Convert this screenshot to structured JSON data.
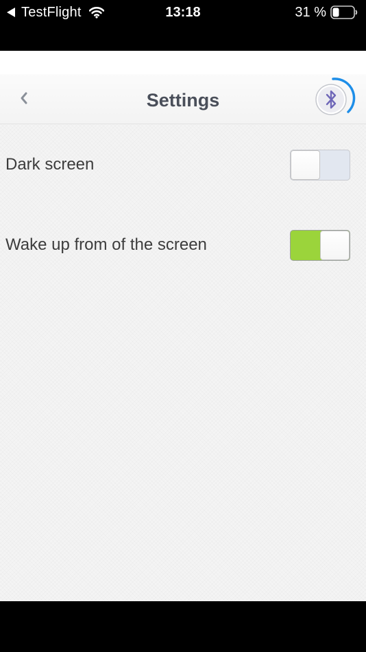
{
  "status_bar": {
    "back_app": "TestFlight",
    "time": "13:18",
    "battery": "31 %",
    "battery_level": 0.31
  },
  "nav": {
    "title": "Settings",
    "back_icon": "chevron-left-icon",
    "bluetooth_icon": "bluetooth-icon"
  },
  "settings": [
    {
      "label": "Dark screen",
      "enabled": false
    },
    {
      "label": "Wake up from of the screen",
      "enabled": true
    }
  ],
  "colors": {
    "toggle_on": "#9bd43b",
    "toggle_off": "#e2e7f0",
    "title_text": "#4a4f5a",
    "bluetooth_accent": "#1e8ee8",
    "bluetooth_glyph": "#6f67b8"
  }
}
